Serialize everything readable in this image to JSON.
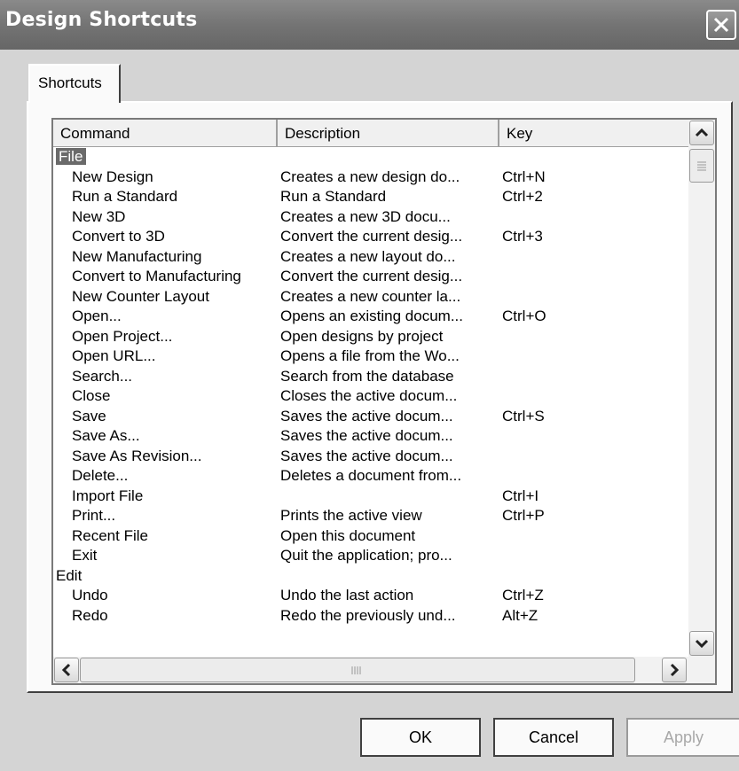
{
  "window": {
    "title": "Design Shortcuts"
  },
  "tabs": [
    {
      "label": "Shortcuts"
    }
  ],
  "table": {
    "columns": [
      "Command",
      "Description",
      "Key"
    ],
    "rows": [
      {
        "type": "group",
        "command": "File",
        "description": "",
        "key": "",
        "selected": true
      },
      {
        "type": "item",
        "command": "New Design",
        "description": "Creates a new design do...",
        "key": "Ctrl+N"
      },
      {
        "type": "item",
        "command": "Run a Standard",
        "description": "Run a Standard",
        "key": "Ctrl+2"
      },
      {
        "type": "item",
        "command": "New 3D",
        "description": "Creates a new 3D docu...",
        "key": ""
      },
      {
        "type": "item",
        "command": "Convert to 3D",
        "description": "Convert the current desig...",
        "key": "Ctrl+3"
      },
      {
        "type": "item",
        "command": "New Manufacturing",
        "description": "Creates a new layout do...",
        "key": ""
      },
      {
        "type": "item",
        "command": "Convert to Manufacturing",
        "description": "Convert the current desig...",
        "key": ""
      },
      {
        "type": "item",
        "command": "New Counter Layout",
        "description": "Creates a new counter la...",
        "key": ""
      },
      {
        "type": "item",
        "command": "Open...",
        "description": "Opens an existing docum...",
        "key": "Ctrl+O"
      },
      {
        "type": "item",
        "command": "Open Project...",
        "description": "Open designs by project",
        "key": ""
      },
      {
        "type": "item",
        "command": "Open URL...",
        "description": "Opens a file from the Wo...",
        "key": ""
      },
      {
        "type": "item",
        "command": "Search...",
        "description": "Search from the database",
        "key": ""
      },
      {
        "type": "item",
        "command": "Close",
        "description": "Closes the active docum...",
        "key": ""
      },
      {
        "type": "item",
        "command": "Save",
        "description": "Saves the active docum...",
        "key": "Ctrl+S"
      },
      {
        "type": "item",
        "command": "Save As...",
        "description": "Saves the active docum...",
        "key": ""
      },
      {
        "type": "item",
        "command": "Save As Revision...",
        "description": "Saves the active docum...",
        "key": ""
      },
      {
        "type": "item",
        "command": "Delete...",
        "description": "Deletes a document from...",
        "key": ""
      },
      {
        "type": "item",
        "command": "Import File",
        "description": "",
        "key": "Ctrl+I"
      },
      {
        "type": "item",
        "command": "Print...",
        "description": "Prints the active view",
        "key": "Ctrl+P"
      },
      {
        "type": "item",
        "command": "Recent File",
        "description": "Open this document",
        "key": ""
      },
      {
        "type": "item",
        "command": "Exit",
        "description": "Quit the application; pro...",
        "key": ""
      },
      {
        "type": "group",
        "command": "Edit",
        "description": "",
        "key": ""
      },
      {
        "type": "item",
        "command": "Undo",
        "description": "Undo the last action",
        "key": "Ctrl+Z"
      },
      {
        "type": "item",
        "command": "Redo",
        "description": "Redo the previously und...",
        "key": "Alt+Z"
      }
    ]
  },
  "buttons": {
    "ok": "OK",
    "cancel": "Cancel",
    "apply": "Apply"
  },
  "colors": {
    "titlebar": "#747474",
    "selection": "#6a6a6a"
  }
}
